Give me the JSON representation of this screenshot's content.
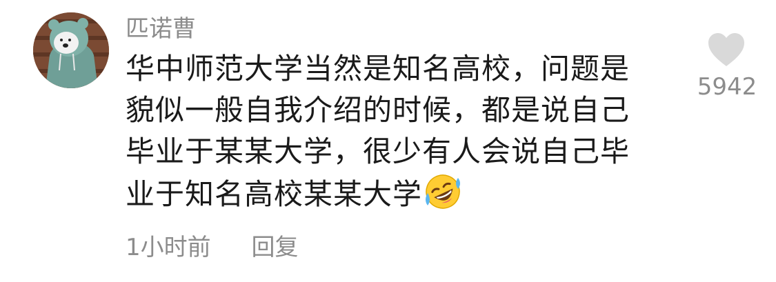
{
  "comment": {
    "username": "匹诺曹",
    "avatar_icon": "bear-avatar-icon",
    "text_lines": [
      "华中师范大学当然是知名高校，问题是",
      "貌似一般自我介绍的时候，都是说自己",
      "毕业于某某大学，很少有人会说自己毕",
      "业于知名高校某某大学"
    ],
    "emoji": "rolling-on-floor-laughing-emoji",
    "timestamp": "1小时前",
    "reply_label": "回复",
    "like_icon": "heart-icon",
    "like_count": "5942"
  },
  "colors": {
    "username": "#8c8c8c",
    "text": "#1a1a1a",
    "meta": "#8c8c8c",
    "heart": "#d9d9d9"
  }
}
